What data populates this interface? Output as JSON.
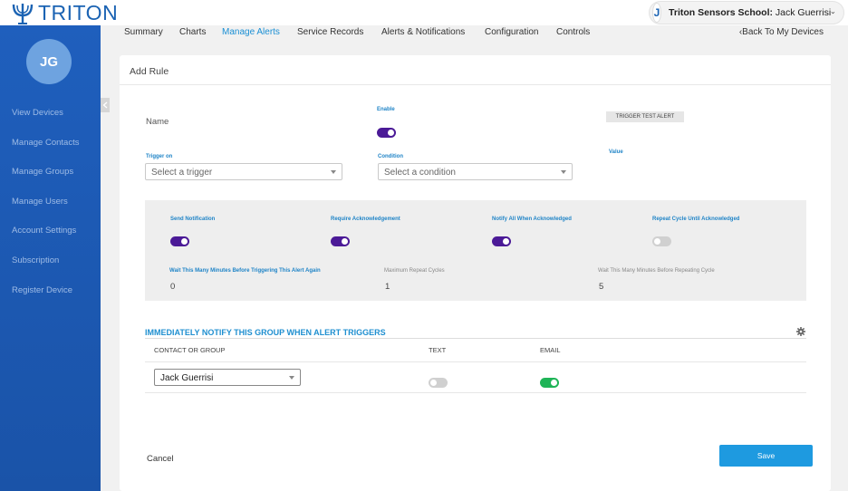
{
  "app": {
    "logo_text": "TRITON"
  },
  "account": {
    "avatar_initial": "J",
    "school_name": "Triton Sensors School:",
    "user_name": "Jack Guerrisi"
  },
  "sidebar": {
    "avatar_initials": "JG",
    "items": [
      {
        "label": "View Devices"
      },
      {
        "label": "Manage Contacts"
      },
      {
        "label": "Manage Groups"
      },
      {
        "label": "Manage Users"
      },
      {
        "label": "Account Settings"
      },
      {
        "label": "Subscription"
      },
      {
        "label": "Register Device"
      }
    ]
  },
  "nav": {
    "items": [
      {
        "label": "Summary"
      },
      {
        "label": "Charts"
      },
      {
        "label": "Manage Alerts"
      },
      {
        "label": "Service Records"
      },
      {
        "label": "Alerts & Notifications"
      },
      {
        "label": "Configuration"
      },
      {
        "label": "Controls"
      }
    ],
    "active": "Manage Alerts",
    "back_label": "‹Back To My Devices"
  },
  "form": {
    "title": "Add Rule",
    "name_label": "Name",
    "enable_label": "Enable",
    "enable_on": true,
    "test_button": "TRIGGER TEST ALERT",
    "trigger_label": "Trigger on",
    "trigger_placeholder": "Select a trigger",
    "condition_label": "Condition",
    "condition_placeholder": "Select a condition",
    "value_label": "Value"
  },
  "options": {
    "send_notification": {
      "label": "Send Notification",
      "on": true
    },
    "require_ack": {
      "label": "Require Acknowledgement",
      "on": true
    },
    "notify_all": {
      "label": "Notify All When Acknowledged",
      "on": true
    },
    "repeat_cycle": {
      "label": "Repeat Cycle Until Acknowledged",
      "on": false
    },
    "wait_minutes": {
      "label": "Wait This Many Minutes Before Triggering This Alert Again",
      "value": "0"
    },
    "max_cycles": {
      "label": "Maximum Repeat Cycles",
      "value": "1"
    },
    "repeat_wait": {
      "label": "Wait This Many Minutes Before Repeating Cycle",
      "value": "5"
    }
  },
  "notify": {
    "title": "IMMEDIATELY NOTIFY THIS GROUP WHEN ALERT TRIGGERS",
    "columns": [
      "CONTACT OR GROUP",
      "TEXT",
      "EMAIL"
    ],
    "rows": [
      {
        "contact": "Jack Guerrisi",
        "text": false,
        "email": true
      }
    ]
  },
  "actions": {
    "cancel": "Cancel",
    "save": "Save"
  },
  "colors": {
    "brand_blue": "#1b63b3",
    "accent_blue": "#1f84c7",
    "toggle_purple": "#4b1a97",
    "toggle_green": "#1fb457",
    "save_blue": "#1e9ae0"
  }
}
